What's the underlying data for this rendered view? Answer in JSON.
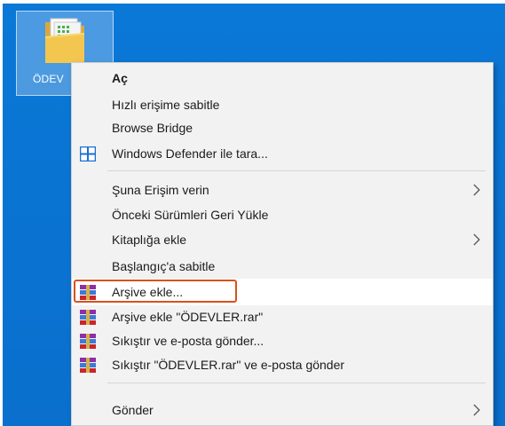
{
  "desktop": {
    "folder_label": "ÖDEV",
    "colors": {
      "background": "#0a78d7",
      "selection": "#c8dcf5"
    }
  },
  "menu": {
    "items": [
      {
        "label": "Aç",
        "bold": true,
        "icon": "",
        "submenu": false
      },
      {
        "label": "Hızlı erişime sabitle",
        "bold": false,
        "icon": "",
        "submenu": false
      },
      {
        "label": "Browse Bridge",
        "bold": false,
        "icon": "",
        "submenu": false
      },
      {
        "label": "Windows Defender ile tara...",
        "bold": false,
        "icon": "windows-defender-icon",
        "submenu": false
      },
      {
        "label": "Şuna Erişim verin",
        "bold": false,
        "icon": "",
        "submenu": true
      },
      {
        "label": "Önceki Sürümleri Geri Yükle",
        "bold": false,
        "icon": "",
        "submenu": false
      },
      {
        "label": "Kitaplığa ekle",
        "bold": false,
        "icon": "",
        "submenu": true
      },
      {
        "label": "Başlangıç'a sabitle",
        "bold": false,
        "icon": "",
        "submenu": false
      },
      {
        "label": "Arşive ekle...",
        "bold": false,
        "icon": "winrar-icon",
        "submenu": false,
        "highlighted": true
      },
      {
        "label": "Arşive ekle \"ÖDEVLER.rar\"",
        "bold": false,
        "icon": "winrar-icon",
        "submenu": false
      },
      {
        "label": "Sıkıştır ve e-posta gönder...",
        "bold": false,
        "icon": "winrar-icon",
        "submenu": false
      },
      {
        "label": "Sıkıştır \"ÖDEVLER.rar\" ve e-posta gönder",
        "bold": false,
        "icon": "winrar-icon",
        "submenu": false
      },
      {
        "label": "Gönder",
        "bold": false,
        "icon": "",
        "submenu": true
      }
    ],
    "colors": {
      "background": "#f2f2f2",
      "highlight_frame": "#d8511b",
      "text": "#1b1b1b"
    }
  }
}
